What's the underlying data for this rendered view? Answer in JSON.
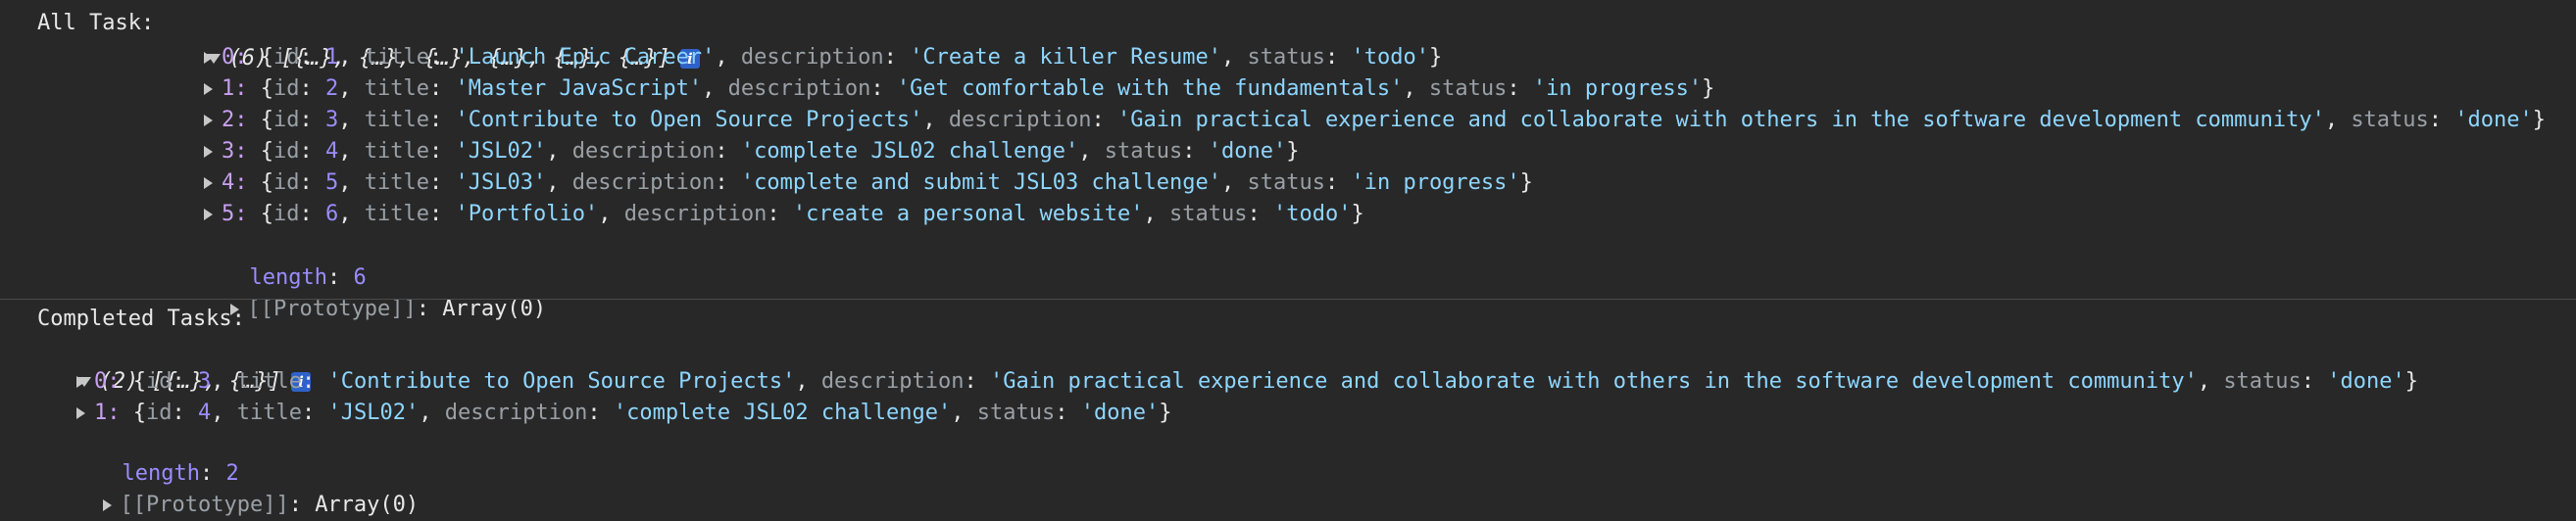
{
  "all_tasks": {
    "label": "All Task:",
    "summary": "(6) [{…}, {…}, {…}, {…}, {…}, {…}]",
    "items": [
      {
        "index": "0:",
        "id": "1",
        "title": "'Launch Epic Career'",
        "description": "'Create a killer Resume'",
        "status": "'todo'"
      },
      {
        "index": "1:",
        "id": "2",
        "title": "'Master JavaScript'",
        "description": "'Get comfortable with the fundamentals'",
        "status": "'in progress'"
      },
      {
        "index": "2:",
        "id": "3",
        "title": "'Contribute to Open Source Projects'",
        "description": "'Gain practical experience and collaborate with others in the software development community'",
        "status": "'done'"
      },
      {
        "index": "3:",
        "id": "4",
        "title": "'JSL02'",
        "description": "'complete JSL02 challenge'",
        "status": "'done'"
      },
      {
        "index": "4:",
        "id": "5",
        "title": "'JSL03'",
        "description": "'complete and submit JSL03 challenge'",
        "status": "'in progress'"
      },
      {
        "index": "5:",
        "id": "6",
        "title": "'Portfolio'",
        "description": "'create a personal website'",
        "status": "'todo'"
      }
    ],
    "length_label": "length",
    "length_value": "6",
    "prototype_label": "[[Prototype]]",
    "prototype_value": "Array(0)"
  },
  "completed_tasks": {
    "label": "Completed Tasks:",
    "summary": "(2) [{…}, {…}]",
    "items": [
      {
        "index": "0:",
        "id": "3",
        "title": "'Contribute to Open Source Projects'",
        "description": "'Gain practical experience and collaborate with others in the software development community'",
        "status": "'done'"
      },
      {
        "index": "1:",
        "id": "4",
        "title": "'JSL02'",
        "description": "'complete JSL02 challenge'",
        "status": "'done'"
      }
    ],
    "length_label": "length",
    "length_value": "2",
    "prototype_label": "[[Prototype]]",
    "prototype_value": "Array(0)"
  },
  "keys": {
    "id": "id",
    "title": "title",
    "description": "description",
    "status": "status"
  },
  "info_icon_glyph": "i"
}
